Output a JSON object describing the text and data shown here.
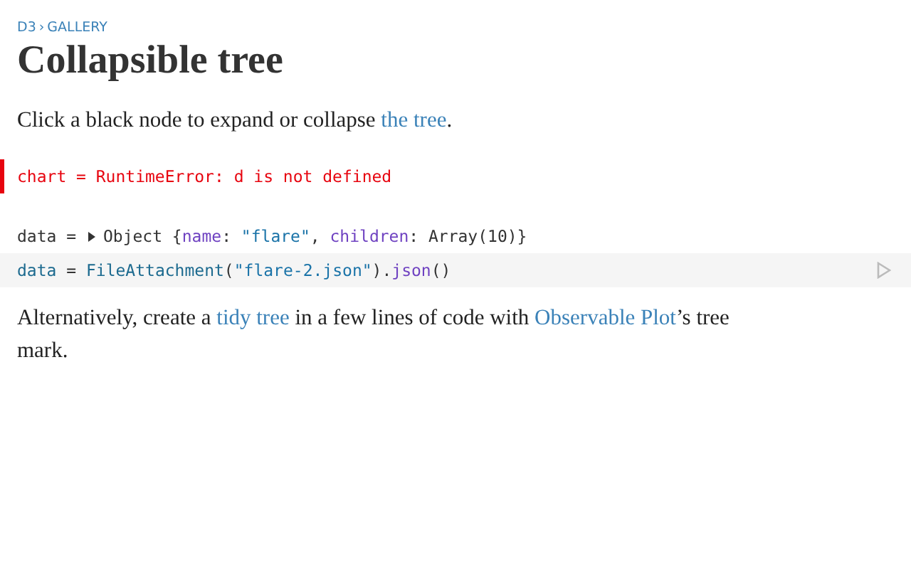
{
  "breadcrumb": {
    "items": [
      "D3",
      "GALLERY"
    ],
    "separator": "›"
  },
  "title": "Collapsible tree",
  "intro": [
    {
      "kind": "text",
      "text": "Click a black node to expand or collapse "
    },
    {
      "kind": "link",
      "text": "the tree"
    },
    {
      "kind": "text",
      "text": "."
    }
  ],
  "cells": [
    {
      "kind": "error",
      "tokens": [
        {
          "kind": "plain",
          "text": "chart = RuntimeError: d is not defined"
        }
      ]
    },
    {
      "kind": "output",
      "expanded": false,
      "tokens": [
        {
          "kind": "plain",
          "text": "data = "
        },
        {
          "kind": "toggle"
        },
        {
          "kind": "plain",
          "text": "Object {"
        },
        {
          "kind": "key",
          "text": "name"
        },
        {
          "kind": "plain",
          "text": ": "
        },
        {
          "kind": "string",
          "text": "\"flare\""
        },
        {
          "kind": "plain",
          "text": ", "
        },
        {
          "kind": "key",
          "text": "children"
        },
        {
          "kind": "plain",
          "text": ": Array(10)}"
        }
      ]
    },
    {
      "kind": "source",
      "tokens": [
        {
          "kind": "name",
          "text": "data"
        },
        {
          "kind": "plain",
          "text": " = "
        },
        {
          "kind": "name",
          "text": "FileAttachment"
        },
        {
          "kind": "plain",
          "text": "("
        },
        {
          "kind": "string",
          "text": "\"flare-2.json\""
        },
        {
          "kind": "plain",
          "text": ")."
        },
        {
          "kind": "key",
          "text": "json"
        },
        {
          "kind": "plain",
          "text": "()"
        }
      ]
    }
  ],
  "outro": [
    {
      "kind": "text",
      "text": "Alternatively, create a "
    },
    {
      "kind": "link",
      "text": "tidy tree"
    },
    {
      "kind": "text",
      "text": " in a few lines of code with "
    },
    {
      "kind": "link",
      "text": "Observable Plot"
    },
    {
      "kind": "text",
      "text": "’s tree mark."
    }
  ]
}
